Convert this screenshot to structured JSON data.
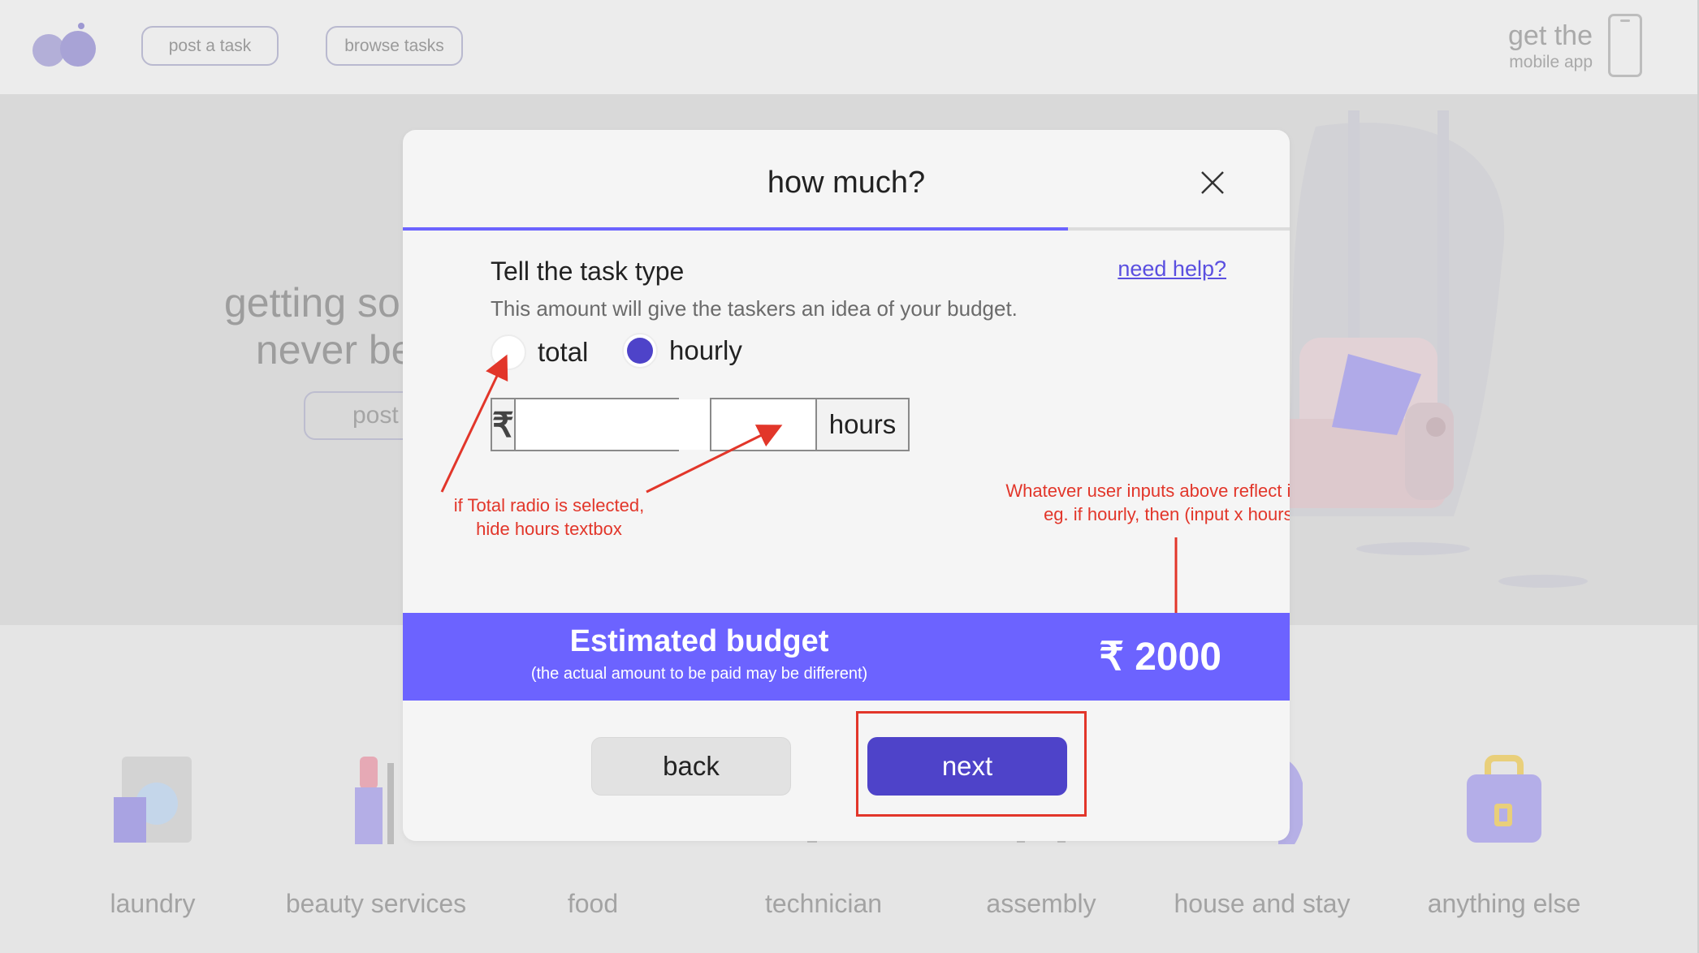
{
  "header": {
    "post_task_label": "post a task",
    "browse_tasks_label": "browse tasks",
    "get_app_line1": "get the",
    "get_app_line2": "mobile app"
  },
  "hero": {
    "line1": "getting someth",
    "line2": "never been",
    "button_label": "post"
  },
  "categories": [
    {
      "label": "laundry",
      "icon": "washing-machine-icon"
    },
    {
      "label": "beauty services",
      "icon": "lipstick-icon"
    },
    {
      "label": "food",
      "icon": "food-icon"
    },
    {
      "label": "technician",
      "icon": "tools-icon"
    },
    {
      "label": "assembly",
      "icon": "assembly-icon"
    },
    {
      "label": "house and stay",
      "icon": "house-icon"
    },
    {
      "label": "anything else",
      "icon": "bag-icon"
    }
  ],
  "modal": {
    "title": "how much?",
    "progress_fraction": 0.75,
    "section_title": "Tell the task type",
    "help_link": "need help?",
    "subtitle": "This amount will give the taskers an idea of your budget.",
    "radio_options": [
      {
        "label": "total",
        "selected": false
      },
      {
        "label": "hourly",
        "selected": true
      }
    ],
    "currency_symbol": "₹",
    "amount_value": "",
    "hours_value": "",
    "hours_unit": "hours",
    "budget": {
      "label": "Estimated budget",
      "note": "(the actual amount to be paid may be different)",
      "value": "₹ 2000"
    },
    "back_label": "back",
    "next_label": "next"
  },
  "annotations": {
    "left": "if Total radio is selected,\nhide hours textbox",
    "right": "Whatever user inputs above reflect it here\neg. if hourly, then (input x hours)"
  },
  "colors": {
    "accent": "#6c63ff",
    "primary_button": "#4e43c9",
    "annotation": "#e2362a"
  }
}
